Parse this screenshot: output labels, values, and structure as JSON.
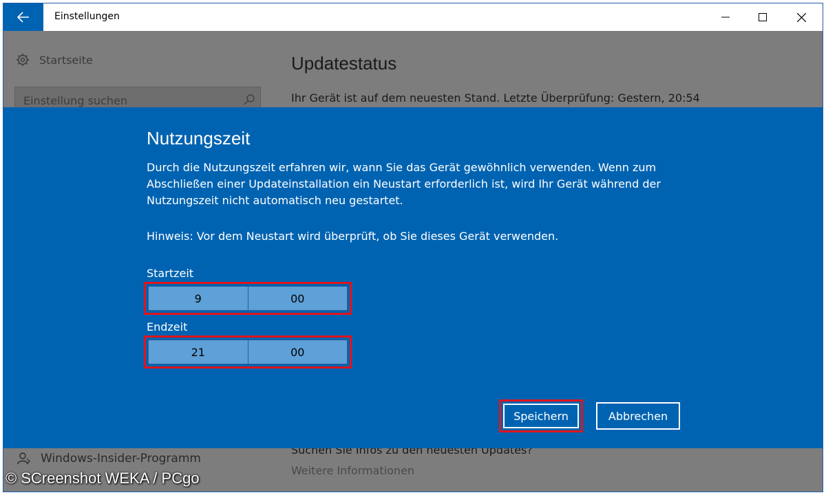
{
  "window": {
    "title": "Einstellungen"
  },
  "sidebar": {
    "home_label": "Startseite",
    "search_placeholder": "Einstellung suchen",
    "insider_label": "Windows-Insider-Programm"
  },
  "background": {
    "heading": "Updatestatus",
    "status": "Ihr Gerät ist auf dem neuesten Stand. Letzte Überprüfung: Gestern, 20:54",
    "search_updates": "Suchen Sie Infos zu den neuesten Updates?",
    "more_info": "Weitere Informationen"
  },
  "dialog": {
    "title": "Nutzungszeit",
    "description": "Durch die Nutzungszeit erfahren wir, wann Sie das Gerät gewöhnlich verwenden. Wenn zum Abschließen einer Updateinstallation ein Neustart erforderlich ist, wird Ihr Gerät während der Nutzungszeit nicht automatisch neu gestartet.",
    "note": "Hinweis: Vor dem Neustart wird überprüft, ob Sie dieses Gerät verwenden.",
    "start_label": "Startzeit",
    "start_hour": "9",
    "start_minute": "00",
    "end_label": "Endzeit",
    "end_hour": "21",
    "end_minute": "00",
    "save_label": "Speichern",
    "cancel_label": "Abbrechen"
  },
  "watermark": "© SCreenshot WEKA / PCgo",
  "colors": {
    "accent": "#0063b1",
    "highlight": "#e1141b",
    "picker": "#5ea0d8"
  }
}
